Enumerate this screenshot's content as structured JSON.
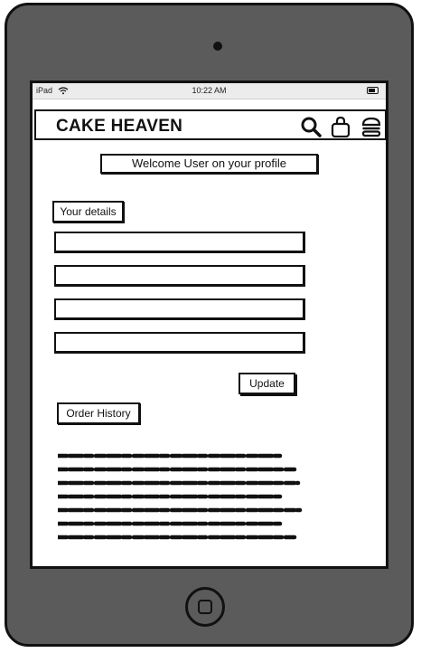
{
  "status_bar": {
    "device": "iPad",
    "time": "10:22 AM"
  },
  "header": {
    "brand": "CAKE HEAVEN",
    "icons": [
      "search-icon",
      "shopping-bag-icon",
      "menu-icon"
    ]
  },
  "profile": {
    "welcome_text": "Welcome User on your profile",
    "details_label": "Your details",
    "fields": [
      {
        "value": "",
        "placeholder": ""
      },
      {
        "value": "",
        "placeholder": ""
      },
      {
        "value": "",
        "placeholder": ""
      },
      {
        "value": "",
        "placeholder": ""
      }
    ],
    "update_label": "Update",
    "order_history_label": "Order History"
  }
}
